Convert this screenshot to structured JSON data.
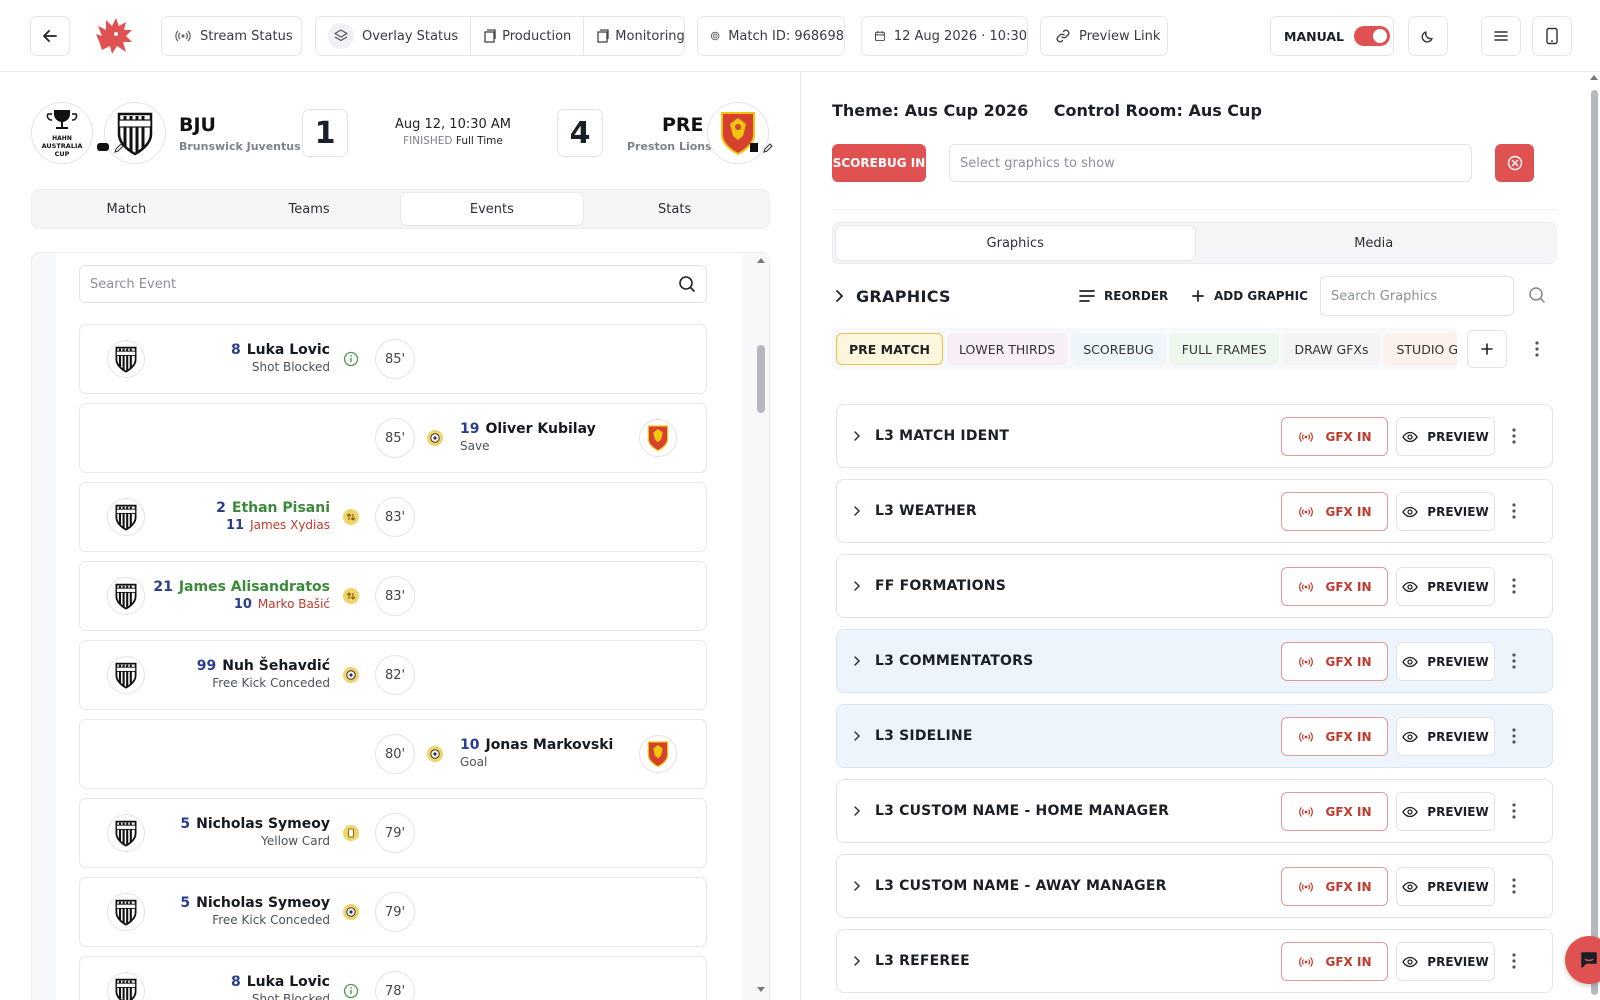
{
  "topbar": {
    "stream_status": "Stream Status",
    "overlay_status": "Overlay Status",
    "production": "Production",
    "monitoring": "Monitoring",
    "match_id": "Match ID: 968698",
    "datetime": "12 Aug 2026 · 10:30",
    "preview_link": "Preview Link",
    "mode_label": "MANUAL",
    "mode_on": true
  },
  "match": {
    "home_abbr": "BJU",
    "home_name": "Brunswick Juventus",
    "home_score": "1",
    "away_abbr": "PRE",
    "away_name": "Preston Lions",
    "away_score": "4",
    "date": "Aug 12, 10:30 AM",
    "status": "FINISHED",
    "status_detail": "Full Time",
    "competition_logo_text": [
      "HAHN",
      "AUSTRALIA",
      "CUP"
    ]
  },
  "left_tabs": [
    "Match",
    "Teams",
    "Events",
    "Stats"
  ],
  "left_active_tab": "Events",
  "events": {
    "search_placeholder": "Search Event",
    "items": [
      {
        "side": "home",
        "num": "8",
        "name": "Luka Lovic",
        "detail": "Shot Blocked",
        "minute": "85'",
        "icon": "info-icon",
        "sub": false
      },
      {
        "side": "away",
        "num": "19",
        "name": "Oliver Kubilay",
        "detail": "Save",
        "minute": "85'",
        "icon": "ball-icon",
        "sub": false
      },
      {
        "side": "home",
        "num": "2",
        "name": "Ethan Pisani",
        "num2": "11",
        "detail": "James Xydias",
        "minute": "83'",
        "icon": "substitution-icon",
        "sub": true
      },
      {
        "side": "home",
        "num": "21",
        "name": "James Alisandratos",
        "num2": "10",
        "detail": "Marko Bašić",
        "minute": "83'",
        "icon": "substitution-icon",
        "sub": true
      },
      {
        "side": "home",
        "num": "99",
        "name": "Nuh Šehavdić",
        "detail": "Free Kick Conceded",
        "minute": "82'",
        "icon": "ball-icon",
        "sub": false
      },
      {
        "side": "away",
        "num": "10",
        "name": "Jonas Markovski",
        "detail": "Goal",
        "minute": "80'",
        "icon": "goal-icon",
        "sub": false
      },
      {
        "side": "home",
        "num": "5",
        "name": "Nicholas Symeoy",
        "detail": "Yellow Card",
        "minute": "79'",
        "icon": "yellow-card-icon",
        "sub": false
      },
      {
        "side": "home",
        "num": "5",
        "name": "Nicholas Symeoy",
        "detail": "Free Kick Conceded",
        "minute": "79'",
        "icon": "ball-icon",
        "sub": false
      },
      {
        "side": "home",
        "num": "8",
        "name": "Luka Lovic",
        "detail": "Shot Blocked",
        "minute": "78'",
        "icon": "info-icon",
        "sub": false
      }
    ]
  },
  "control": {
    "theme": "Theme: Aus Cup 2026",
    "control_room": "Control Room: Aus Cup",
    "scorebug_in": "SCOREBUG IN",
    "select_placeholder": "Select graphics to show",
    "tabs": [
      "Graphics",
      "Media"
    ],
    "active_tab": "Graphics",
    "graphics_title": "GRAPHICS",
    "reorder": "REORDER",
    "add_graphic": "ADD GRAPHIC",
    "search_placeholder": "Search Graphics",
    "categories": [
      "PRE MATCH",
      "LOWER THIRDS",
      "SCOREBUG",
      "FULL FRAMES",
      "DRAW GFXs",
      "STUDIO G"
    ],
    "active_category": "PRE MATCH",
    "gfx_in_label": "GFX IN",
    "preview_label": "PREVIEW",
    "graphics": [
      {
        "name": "L3 MATCH IDENT",
        "highlight": false
      },
      {
        "name": "L3 WEATHER",
        "highlight": false
      },
      {
        "name": "FF FORMATIONS",
        "highlight": false
      },
      {
        "name": "L3 COMMENTATORS",
        "highlight": true
      },
      {
        "name": "L3 SIDELINE",
        "highlight": true
      },
      {
        "name": "L3 CUSTOM NAME - HOME MANAGER",
        "highlight": false
      },
      {
        "name": "L3 CUSTOM NAME - AWAY MANAGER",
        "highlight": false
      },
      {
        "name": "L3 REFEREE",
        "highlight": false
      }
    ]
  },
  "colors": {
    "accent": "#e05252",
    "away_primary": "#d6402f",
    "away_secondary": "#f1c40f",
    "home_stripe": "#1b1f27"
  }
}
